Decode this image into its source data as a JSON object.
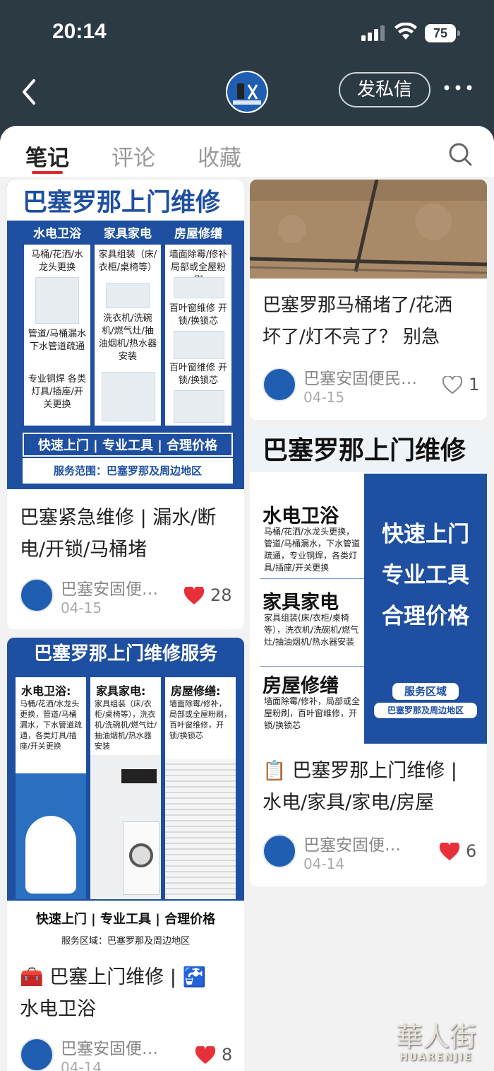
{
  "status": {
    "time": "20:14",
    "battery": "75"
  },
  "nav": {
    "message_button": "发私信"
  },
  "tabs": [
    {
      "label": "笔记"
    },
    {
      "label": "评论"
    },
    {
      "label": "收藏"
    }
  ],
  "cards": [
    {
      "title_line1": "巴塞紧急维修 | 漏水/断",
      "title_line2": "电/开锁/马桶堵",
      "author": "巴塞安固便…",
      "date": "04-15",
      "likes": "28",
      "poster": {
        "headline": "巴塞罗那上门维修",
        "col1": "水电卫浴",
        "col2": "家具家电",
        "col3": "房屋修缮",
        "col1_text": "马桶/花洒/水龙头更换",
        "col1_text2": "管道/马桶漏水下水管道疏通",
        "col1_text3": "专业铜焊 各类灯具/插座/开关更换",
        "col2_text": "家具组装（床/衣柜/桌椅等）",
        "col2_text2": "洗衣机/洗碗机/燃气灶/抽油烟机/热水器安装",
        "col3_text": "墙面除霉/修补 局部或全屋粉刷",
        "col3_text2": "百叶窗维修 开锁/换锁芯",
        "col3_text3": "百叶窗维修 开锁/换锁芯",
        "strip": "快速上门 | 专业工具 | 合理价格",
        "range": "服务范围：巴塞罗那及周边地区"
      }
    },
    {
      "title_line1": "巴塞罗那马桶堵了/花洒",
      "title_line2": "坏了/灯不亮了？ 别急",
      "author": "巴塞安固便民…",
      "date": "04-15",
      "likes": "1"
    },
    {
      "title_line1": "🧰 巴塞上门维修 | 🚰",
      "title_line2": "水电卫浴",
      "author": "巴塞安固便…",
      "date": "04-14",
      "likes": "8",
      "poster": {
        "headline": "巴塞罗那上门维修服务",
        "col1": "水电卫浴:",
        "col2": "家具家电:",
        "col3": "房屋修缮:",
        "col1_text": "马桶/花洒/水龙头更换，管道/马桶漏水，下水管道疏通，各类灯具/插座/开关更换",
        "col2_text": "家具组装（床/衣柜/桌椅等），洗衣机/洗碗机/燃气灶/抽油烟机/热水器安装",
        "col3_text": "墙面除霉/修补，局部或全屋粉刷，百叶窗维修，开锁/换锁芯",
        "strip": "快速上门 | 专业工具 | 合理价格",
        "range": "服务区域：巴塞罗那及周边地区"
      }
    },
    {
      "title_line1": "📋 巴塞罗那上门维修 |",
      "title_line2": "水电/家具/家电/房屋",
      "author": "巴塞安固便…",
      "date": "04-14",
      "likes": "6",
      "poster": {
        "headline": "巴塞罗那上门维修",
        "col1": "水电卫浴",
        "col1_text": "马桶/花洒/水龙头更换，管道/马桶漏水，下水管道疏通，专业铜焊，各类灯具/插座/开关更换",
        "col2": "家具家电",
        "col2_text": "家具组装(床/衣柜/桌椅等），洗衣机/洗碗机/燃气灶/抽油烟机/热水器安装",
        "col3": "房屋修缮",
        "col3_text": "墙面除霉/修补，局部或全屋粉刷，百叶窗维修，开锁/换锁芯",
        "slogan1": "快速上门",
        "slogan2": "专业工具",
        "slogan3": "合理价格",
        "area_label": "服务区域",
        "area": "巴塞罗那及周边地区"
      }
    }
  ],
  "watermark": {
    "cn": "華人街",
    "en": "HUARENJIE"
  }
}
